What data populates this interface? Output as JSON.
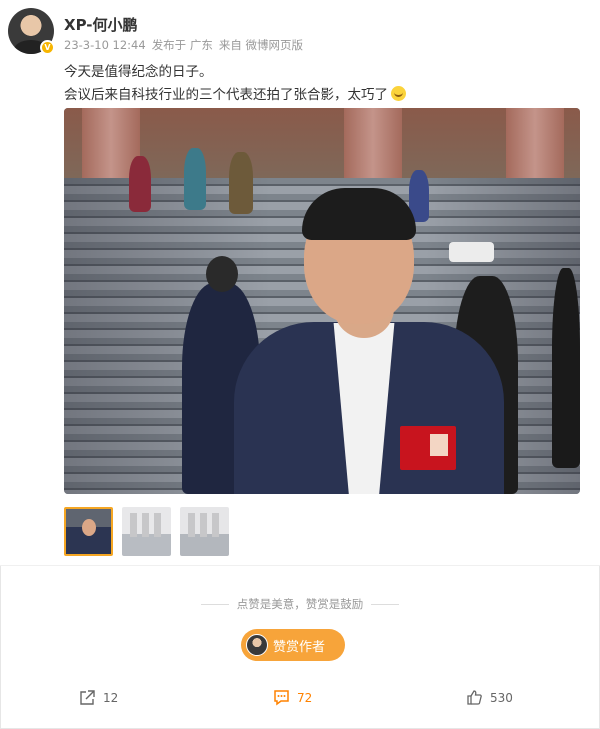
{
  "author": {
    "name": "XP-何小鹏",
    "verified": "V"
  },
  "post": {
    "date": "23-3-10 12:44",
    "location": "发布于 广东",
    "source": "来自 微博网页版",
    "line1": "今天是值得纪念的日子。",
    "line2": "会议后来自科技行业的三个代表还拍了张合影，太巧了"
  },
  "emoji": "smile-emoji",
  "encourage_text": "点赞是美意，赞赏是鼓励",
  "reward_label": "赞赏作者",
  "actions": {
    "share_count": "12",
    "comment_count": "72",
    "like_count": "530"
  },
  "colors": {
    "accent": "#ff8200",
    "reward_button": "#f7a43a",
    "verified_badge": "#f7b500",
    "meta_text": "#999999"
  },
  "icons": [
    "share-icon",
    "comment-icon",
    "like-icon",
    "verified-badge-icon"
  ]
}
